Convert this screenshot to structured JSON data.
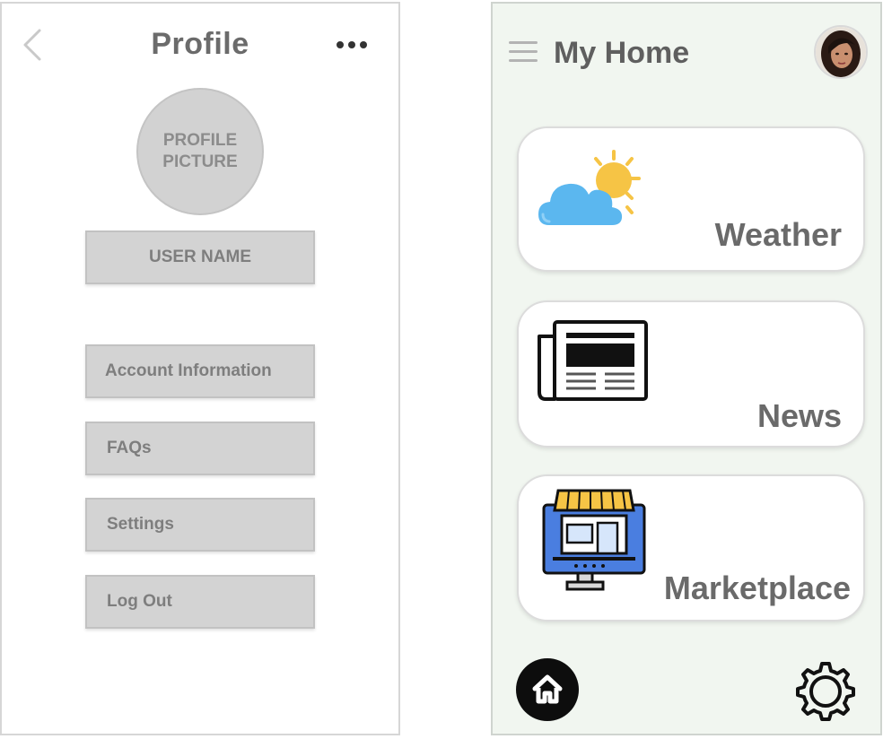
{
  "profile_screen": {
    "title": "Profile",
    "avatar_placeholder": "PROFILE PICTURE",
    "username_placeholder": "USER NAME",
    "menu": [
      {
        "label": "Account Information"
      },
      {
        "label": "FAQs"
      },
      {
        "label": "Settings"
      },
      {
        "label": "Log Out"
      }
    ],
    "icons": {
      "back": "chevron-left-icon",
      "more": "ellipsis-icon"
    }
  },
  "home_screen": {
    "title": "My Home",
    "cards": [
      {
        "label": "Weather",
        "icon": "weather-icon"
      },
      {
        "label": "News",
        "icon": "newspaper-icon"
      },
      {
        "label": "Marketplace",
        "icon": "marketplace-icon"
      }
    ],
    "bottom_nav": {
      "home_icon": "home-icon",
      "settings_icon": "gear-icon"
    },
    "icons": {
      "menu": "hamburger-icon",
      "avatar": "user-avatar"
    }
  },
  "colors": {
    "home_background": "#f1f6f0",
    "wireframe_box": "#d3d3d3",
    "text_gray": "#6a6a6a",
    "cloud_blue": "#5bb7ef",
    "sun_yellow": "#f6c445",
    "market_blue": "#4a7ee0"
  }
}
